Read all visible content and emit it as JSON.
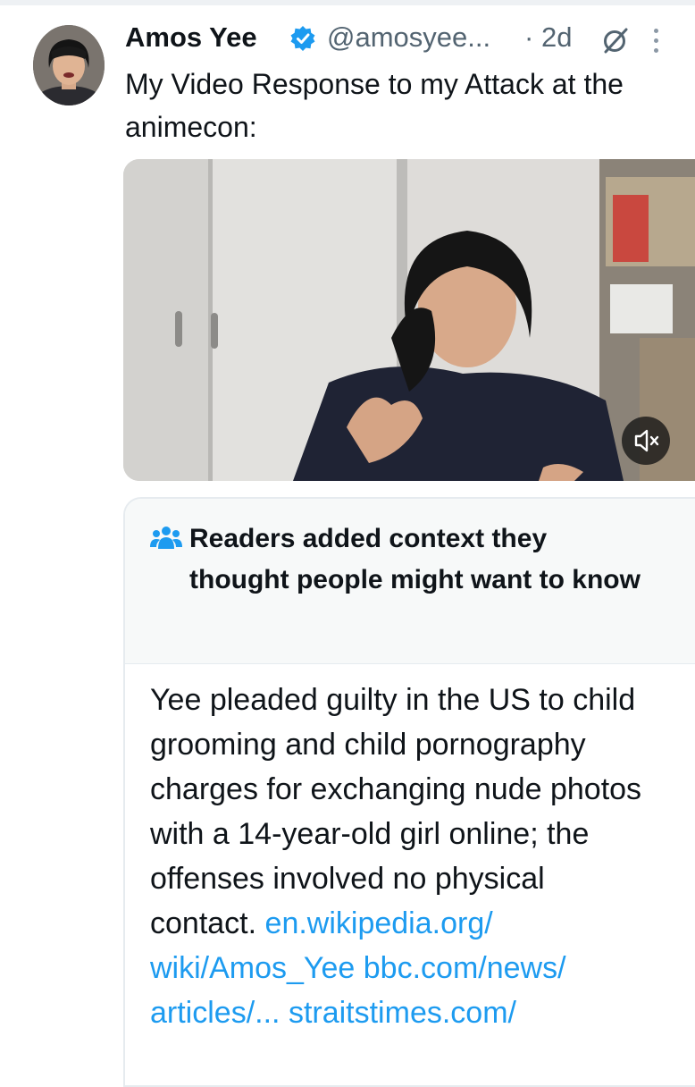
{
  "tweet": {
    "author_name": "Amos Yee",
    "handle": "@amosyee...",
    "separator": "·",
    "age": "2d",
    "text": "My Video Response to my Attack at the animecon:"
  },
  "video": {
    "muted": true
  },
  "community_note": {
    "title": "Readers added context they thought people might want to know",
    "body": "Yee pleaded guilty in the US to child grooming and child pornography charges for exchanging nude photos with a 14-year-old girl online; the offenses involved no physical contact.",
    "links": [
      "en.wikipedia.org/ wiki/Amos_Yee",
      "bbc.com/news/ articles/...",
      "straitstimes.com/"
    ]
  },
  "colors": {
    "text": "#0f1419",
    "secondary": "#536471",
    "link": "#1d9bf0",
    "verified": "#1d9bf0",
    "note_header_bg": "#f7f9f9"
  },
  "icons": [
    "verified-badge-icon",
    "grok-icon",
    "more-icon",
    "mute-icon",
    "community-notes-icon"
  ]
}
